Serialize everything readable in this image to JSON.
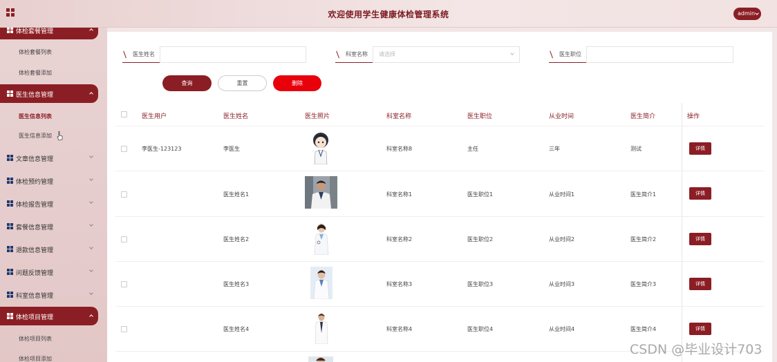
{
  "header": {
    "title": "欢迎使用学生健康体检管理系统",
    "admin_label": "admin"
  },
  "sidebar": {
    "groups": [
      {
        "label": "体检套餐管理",
        "active": true
      },
      {
        "label": "医生信息管理",
        "active": true
      },
      {
        "label": "文章信息管理",
        "active": false
      },
      {
        "label": "体检预约管理",
        "active": false
      },
      {
        "label": "体检报告管理",
        "active": false
      },
      {
        "label": "套餐信息管理",
        "active": false
      },
      {
        "label": "退款信息管理",
        "active": false
      },
      {
        "label": "问题反馈管理",
        "active": false
      },
      {
        "label": "科室信息管理",
        "active": false
      },
      {
        "label": "体检项目管理",
        "active": true
      }
    ],
    "subitems": [
      {
        "label": "体检套餐列表"
      },
      {
        "label": "体检套餐添加"
      },
      {
        "label": "医生信息列表",
        "current": true
      },
      {
        "label": "医生信息添加"
      },
      {
        "label": "体检项目列表"
      },
      {
        "label": "体检项目添加"
      }
    ]
  },
  "filters": {
    "doctor_name_label": "医生姓名",
    "department_label": "科室名称",
    "department_placeholder": "请选择",
    "title_label": "医生职位"
  },
  "buttons": {
    "query": "查询",
    "reset": "重置",
    "delete": "删除",
    "detail": "详情"
  },
  "table": {
    "headers": [
      "医生用户",
      "医生姓名",
      "医生照片",
      "科室名称",
      "医生职位",
      "从业时间",
      "医生简介",
      "操作"
    ],
    "rows": [
      {
        "user": "李医生-123123",
        "name": "李医生",
        "dept": "科室名称8",
        "title": "主任",
        "years": "三年",
        "intro": "测试"
      },
      {
        "user": "",
        "name": "医生姓名1",
        "dept": "科室名称1",
        "title": "医生职位1",
        "years": "从业时间1",
        "intro": "医生简介1"
      },
      {
        "user": "",
        "name": "医生姓名2",
        "dept": "科室名称2",
        "title": "医生职位2",
        "years": "从业时间2",
        "intro": "医生简介2"
      },
      {
        "user": "",
        "name": "医生姓名3",
        "dept": "科室名称3",
        "title": "医生职位3",
        "years": "从业时间3",
        "intro": "医生简介3"
      },
      {
        "user": "",
        "name": "医生姓名4",
        "dept": "科室名称4",
        "title": "医生职位4",
        "years": "从业时间4",
        "intro": "医生简介4"
      }
    ]
  },
  "watermark": "CSDN @毕业设计703",
  "colors": {
    "accent": "#8b1e24",
    "danger": "#e8000b"
  }
}
